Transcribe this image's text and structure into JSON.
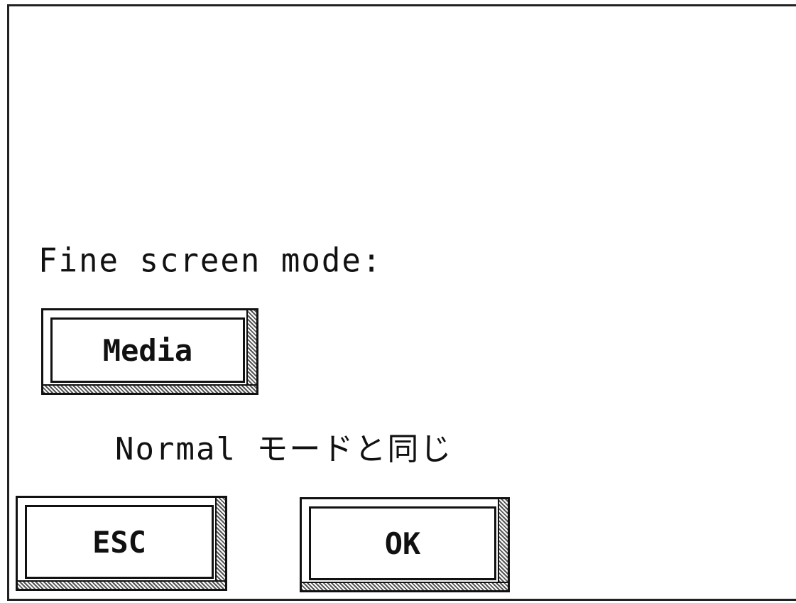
{
  "dialog": {
    "mode_label": "Fine screen mode:",
    "mode_button_label": "Media",
    "mode_description": "Normal モードと同じ",
    "esc_label": "ESC",
    "ok_label": "OK"
  }
}
